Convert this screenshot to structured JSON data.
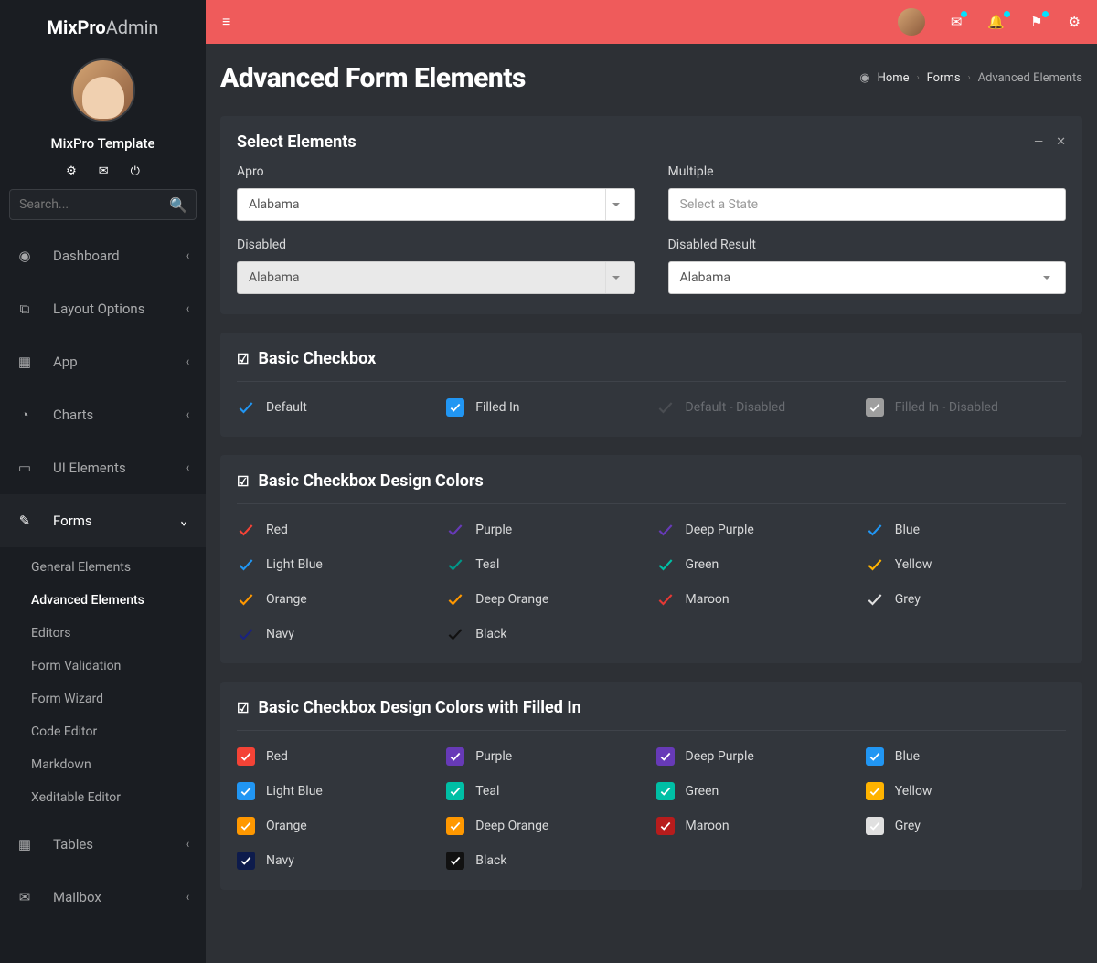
{
  "brand": {
    "strong": "MixPro",
    "light": "Admin"
  },
  "profile": {
    "name": "MixPro Template"
  },
  "search": {
    "placeholder": "Search..."
  },
  "nav": [
    {
      "icon": "dashboard",
      "label": "Dashboard",
      "chev": "left"
    },
    {
      "icon": "layout",
      "label": "Layout Options",
      "chev": "left"
    },
    {
      "icon": "app",
      "label": "App",
      "chev": "left"
    },
    {
      "icon": "charts",
      "label": "Charts",
      "chev": "left"
    },
    {
      "icon": "ui",
      "label": "UI Elements",
      "chev": "left"
    },
    {
      "icon": "forms",
      "label": "Forms",
      "chev": "down",
      "active": true
    },
    {
      "icon": "tables",
      "label": "Tables",
      "chev": "left"
    },
    {
      "icon": "mailbox",
      "label": "Mailbox",
      "chev": "left"
    }
  ],
  "forms_sub": [
    "General Elements",
    "Advanced Elements",
    "Editors",
    "Form Validation",
    "Form Wizard",
    "Code Editor",
    "Markdown",
    "Xeditable Editor"
  ],
  "page": {
    "title": "Advanced Form Elements"
  },
  "breadcrumb": {
    "home": "Home",
    "forms": "Forms",
    "current": "Advanced Elements"
  },
  "select_panel": {
    "title": "Select Elements",
    "fields": {
      "apro": {
        "label": "Apro",
        "value": "Alabama"
      },
      "multiple": {
        "label": "Multiple",
        "placeholder": "Select a State"
      },
      "disabled": {
        "label": "Disabled",
        "value": "Alabama"
      },
      "disabled_result": {
        "label": "Disabled Result",
        "value": "Alabama"
      }
    }
  },
  "basic_cb": {
    "title": "Basic Checkbox",
    "items": [
      {
        "label": "Default",
        "type": "outline",
        "color": "#2196f3"
      },
      {
        "label": "Filled In",
        "type": "filled",
        "color": "#2196f3"
      },
      {
        "label": "Default - Disabled",
        "type": "outline",
        "color": "#4a4d52",
        "muted": true
      },
      {
        "label": "Filled In - Disabled",
        "type": "filled",
        "color": "#9e9e9e",
        "muted": true
      }
    ]
  },
  "color_cb": {
    "title": "Basic Checkbox Design Colors",
    "items": [
      {
        "label": "Red",
        "color": "#f44336"
      },
      {
        "label": "Purple",
        "color": "#673ab7"
      },
      {
        "label": "Deep Purple",
        "color": "#673ab7"
      },
      {
        "label": "Blue",
        "color": "#2196f3"
      },
      {
        "label": "Light Blue",
        "color": "#2196f3"
      },
      {
        "label": "Teal",
        "color": "#009688"
      },
      {
        "label": "Green",
        "color": "#00bfa5"
      },
      {
        "label": "Yellow",
        "color": "#ffb300"
      },
      {
        "label": "Orange",
        "color": "#ff9800"
      },
      {
        "label": "Deep Orange",
        "color": "#ff9800"
      },
      {
        "label": "Maroon",
        "color": "#e53935"
      },
      {
        "label": "Grey",
        "color": "#e0e0e0"
      },
      {
        "label": "Navy",
        "color": "#1a237e"
      },
      {
        "label": "Black",
        "color": "#111111"
      }
    ]
  },
  "filled_cb": {
    "title": "Basic Checkbox Design Colors with Filled In",
    "items": [
      {
        "label": "Red",
        "color": "#f44336"
      },
      {
        "label": "Purple",
        "color": "#673ab7"
      },
      {
        "label": "Deep Purple",
        "color": "#673ab7"
      },
      {
        "label": "Blue",
        "color": "#2196f3"
      },
      {
        "label": "Light Blue",
        "color": "#2196f3"
      },
      {
        "label": "Teal",
        "color": "#00bfa5"
      },
      {
        "label": "Green",
        "color": "#00bfa5"
      },
      {
        "label": "Yellow",
        "color": "#ffb300"
      },
      {
        "label": "Orange",
        "color": "#ff9800"
      },
      {
        "label": "Deep Orange",
        "color": "#ff9800"
      },
      {
        "label": "Maroon",
        "color": "#b71c1c"
      },
      {
        "label": "Grey",
        "color": "#e0e0e0"
      },
      {
        "label": "Navy",
        "color": "#0d1b4c"
      },
      {
        "label": "Black",
        "color": "#111111"
      }
    ]
  }
}
